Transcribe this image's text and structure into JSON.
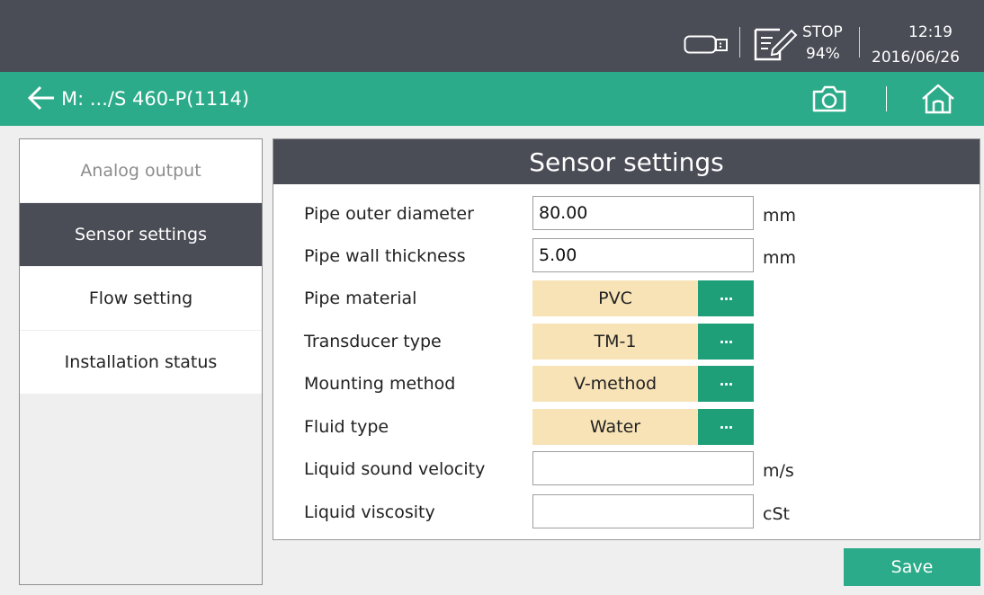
{
  "status": {
    "state": "STOP",
    "percent": "94%",
    "time": "12:19",
    "date": "2016/06/26",
    "icons": [
      "battery-icon",
      "edit-note-icon"
    ]
  },
  "nav": {
    "title": "M: .../S 460-P(1114)",
    "icons": [
      "back-arrow-icon",
      "camera-icon",
      "home-icon"
    ]
  },
  "sidebar": {
    "items": [
      {
        "label": "Analog output"
      },
      {
        "label": "Sensor settings"
      },
      {
        "label": "Flow setting"
      },
      {
        "label": "Installation status"
      }
    ]
  },
  "panel": {
    "title": "Sensor settings",
    "outer_diameter": {
      "label": "Pipe outer diameter",
      "value": "80.00",
      "unit": "mm"
    },
    "wall_thickness": {
      "label": "Pipe wall thickness",
      "value": "5.00",
      "unit": "mm"
    },
    "material": {
      "label": "Pipe material",
      "value": "PVC"
    },
    "transducer": {
      "label": "Transducer type",
      "value": "TM-1"
    },
    "mounting": {
      "label": "Mounting method",
      "value": "V-method"
    },
    "fluid": {
      "label": "Fluid type",
      "value": "Water"
    },
    "sound_velocity": {
      "label": "Liquid sound velocity",
      "value": "",
      "unit": "m/s"
    },
    "viscosity": {
      "label": "Liquid viscosity",
      "value": "",
      "unit": "cSt"
    }
  },
  "save_label": "Save",
  "colors": {
    "topbar": "#4a4c56",
    "accent": "#2bab89",
    "select_bg": "#f8e3b7",
    "dots_button": "#1f9f78"
  }
}
